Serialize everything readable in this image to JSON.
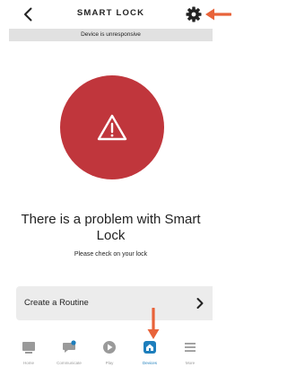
{
  "header": {
    "title": "SMART LOCK",
    "back_icon": "chevron-left-icon",
    "settings_icon": "gear-icon"
  },
  "banner": {
    "text": "Device is unresponsive"
  },
  "status": {
    "icon": "warning-icon",
    "color": "#c0363c",
    "title": "There is a problem with Smart Lock",
    "subtitle": "Please check on your lock"
  },
  "routine": {
    "label": "Create a Routine",
    "icon": "chevron-right-icon"
  },
  "nav": {
    "items": [
      {
        "label": "Home",
        "icon": "home-icon"
      },
      {
        "label": "Communicate",
        "icon": "chat-icon"
      },
      {
        "label": "Play",
        "icon": "play-icon"
      },
      {
        "label": "Devices",
        "icon": "devices-icon",
        "active": true
      },
      {
        "label": "More",
        "icon": "menu-icon"
      }
    ],
    "active_color": "#1d7ebc",
    "inactive_color": "#9a9a9a"
  },
  "annotations": {
    "arrow_color": "#e8633a"
  }
}
